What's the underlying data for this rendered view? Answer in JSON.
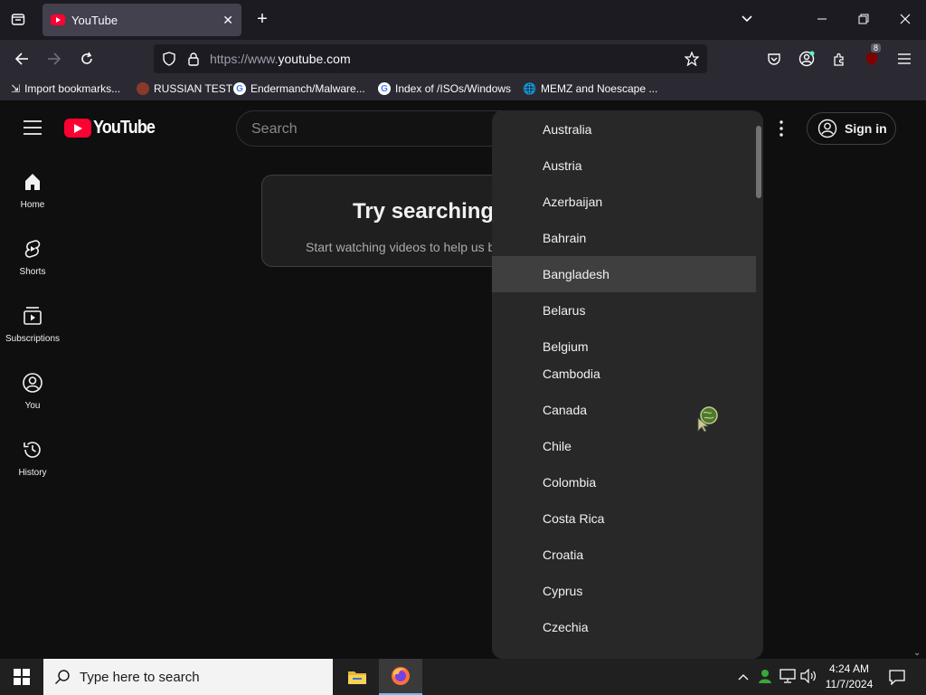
{
  "browser": {
    "tab_title": "YouTube",
    "url_proto": "https://www.",
    "url_host": "youtube.com",
    "extension_badge": "8",
    "bookmarks": [
      {
        "label": "Import bookmarks..."
      },
      {
        "label": "RUSSIAN TEST"
      },
      {
        "label": "Endermanch/Malware..."
      },
      {
        "label": "Index of /ISOs/Windows"
      },
      {
        "label": "MEMZ and Noescape ..."
      }
    ]
  },
  "youtube": {
    "logo_text": "YouTube",
    "search_placeholder": "Search",
    "sign_in": "Sign in",
    "sidebar": [
      {
        "label": "Home",
        "icon": "home-icon"
      },
      {
        "label": "Shorts",
        "icon": "shorts-icon"
      },
      {
        "label": "Subscriptions",
        "icon": "subscriptions-icon"
      },
      {
        "label": "You",
        "icon": "you-icon"
      },
      {
        "label": "History",
        "icon": "history-icon"
      }
    ],
    "promo": {
      "title": "Try searching",
      "subtitle": "Start watching videos to help us b"
    }
  },
  "country_dropdown": {
    "highlighted": "Bangladesh",
    "options": [
      "Australia",
      "Austria",
      "Azerbaijan",
      "Bahrain",
      "Bangladesh",
      "Belarus",
      "Belgium",
      "Cambodia",
      "Canada",
      "Chile",
      "Colombia",
      "Costa Rica",
      "Croatia",
      "Cyprus",
      "Czechia"
    ]
  },
  "taskbar": {
    "search_placeholder": "Type here to search",
    "time": "4:24 AM",
    "date": "11/7/2024"
  },
  "colors": {
    "youtube_red": "#ff0033",
    "dropdown_bg": "#282828",
    "highlight_bg": "#3f3f3f"
  }
}
